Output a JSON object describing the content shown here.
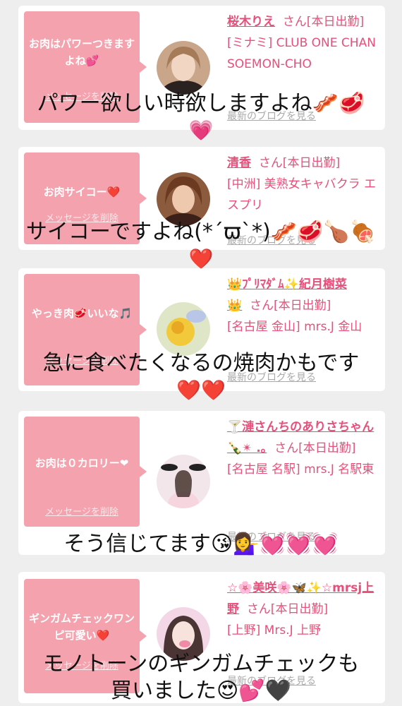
{
  "cards": [
    {
      "message": "お肉はパワーつきますよね💕",
      "delete_label": "メッセージを削除",
      "girl_name": "桜木りえ",
      "suffix": "さん[本日出勤]",
      "shop": "[ミナミ] CLUB ONE CHAN SOEMON-CHO",
      "blog_label": "最新のブログを見る"
    },
    {
      "message": "お肉サイコー❤️",
      "delete_label": "メッセージを削除",
      "girl_name": "清香",
      "suffix": "さん[本日出勤]",
      "shop": "[中洲] 美熟女キャバクラ エスプリ",
      "blog_label": "最新のブログを見る"
    },
    {
      "message": "やっき肉🥩いいな🎵",
      "delete_label": "メッセージを削除",
      "girl_name": "👑ﾌﾟﾘﾏﾀﾞﾑ✨紀月樹菜👑",
      "suffix": "さん[本日出勤]",
      "shop": "[名古屋 金山] mrs.J 金山",
      "blog_label": "最新のブログを見る"
    },
    {
      "message": "お肉は０カロリー❤︎",
      "delete_label": "メッセージを削除",
      "girl_name": "🍸漣さんちのありさちゃん🍾✴︎ .｡",
      "suffix": "さん[本日出勤]",
      "shop": "[名古屋 名駅] mrs.J 名駅東",
      "blog_label": "最新のブログを見る"
    },
    {
      "message": "ギンガムチェックワンピ可愛い❤️",
      "delete_label": "メッセージを削除",
      "girl_name": "☆🌸美咲🌸🦋✨☆mrsj上野",
      "suffix": "さん[本日出勤]",
      "shop": "[上野] Mrs.J 上野",
      "blog_label": "最新のブログを見る"
    }
  ],
  "overlay_captions": [
    {
      "line1": "パワー欲しい時欲しますよね🥓🥩",
      "line2": "💗"
    },
    {
      "line1": "サイコーですよね(*´ϖ`*)🥓🥩🍗🍖",
      "line2": "❤️"
    },
    {
      "line1": "急に食べたくなるの焼肉かもです",
      "line2": "❤️❤️"
    },
    {
      "line1": "そう信じてます😘💁‍♀️💓💓💓",
      "line2": ""
    },
    {
      "line1": "モノトーンのギンガムチェックも",
      "line2": "買いました😍💕🖤"
    }
  ],
  "colors": {
    "bubble": "#f4a3ae",
    "name_pink": "#e7507a",
    "background": "#eeeeee"
  }
}
